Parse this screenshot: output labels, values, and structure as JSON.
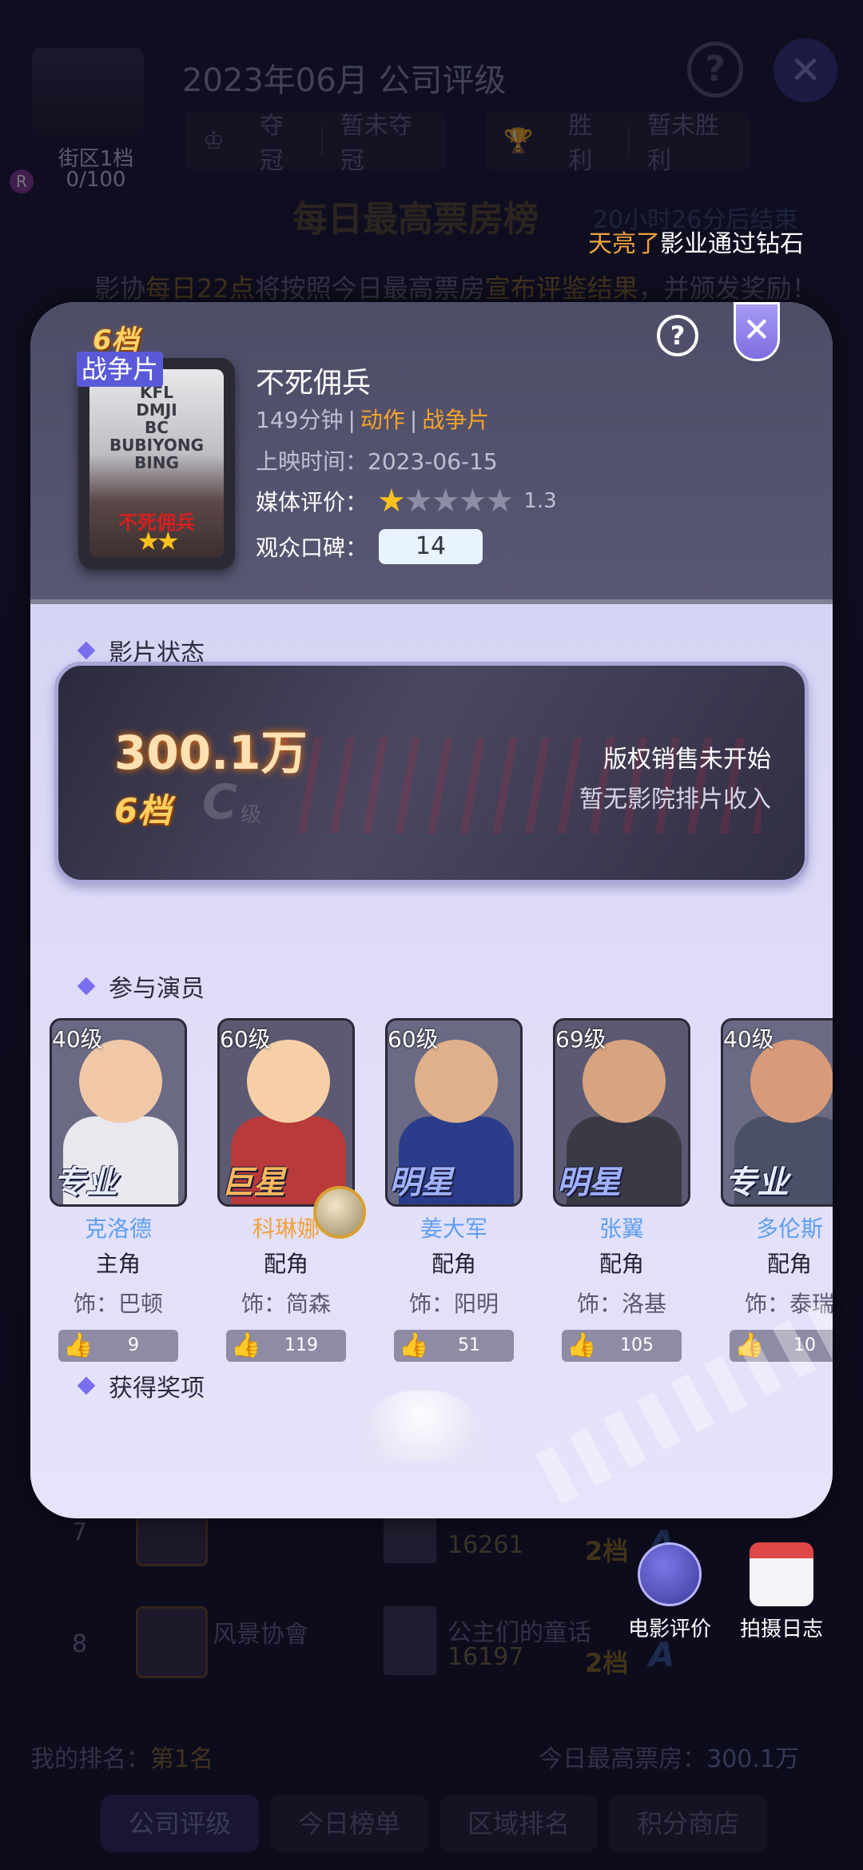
{
  "background": {
    "district_level": "街区1档",
    "progress": "0/100",
    "badge_r": "R",
    "title": "2023年06月 公司评级",
    "help_icon": "help-icon",
    "close_icon": "close-icon",
    "champion": {
      "label": "夺冠",
      "value": "暂未夺冠"
    },
    "victory": {
      "label": "胜利",
      "value": "暂未胜利"
    },
    "banner": "每日最高票房榜",
    "countdown": "20小时26分后结束",
    "ticker": {
      "name": "天亮了",
      "rest": "影业通过钻石"
    },
    "notice": {
      "p1": "影协",
      "h1": "每日22点",
      "p2": "将按照今日最高票房",
      "h2": "宣布评鉴结果",
      "p3": "，并颁发奖励！"
    },
    "rows": [
      {
        "rank": "7",
        "company": "",
        "movie": "",
        "box_office": "16261",
        "tier": "2档",
        "grade": "A"
      },
      {
        "rank": "8",
        "company": "风景协會",
        "movie": "公主们的童话",
        "box_office": "16197",
        "tier": "2档",
        "grade": "A"
      }
    ],
    "my_rank": {
      "label": "我的排名：",
      "value": "第1名"
    },
    "today_best": {
      "label": "今日最高票房：",
      "value": "300.1万"
    },
    "tabs": [
      "公司评级",
      "今日榜单",
      "区域排名",
      "积分商店"
    ]
  },
  "shortcuts": [
    {
      "label": "电影评价",
      "icon": "pen-icon"
    },
    {
      "label": "拍摄日志",
      "icon": "calendar-icon"
    }
  ],
  "movie": {
    "tier_badge": "6档",
    "genre_tag": "战争片",
    "poster_text": "KFL\nDMJI\nBC\nBUBIYONG\nBING",
    "poster_title": "不死佣兵",
    "title": "不死佣兵",
    "duration": "149分钟",
    "genre1": "动作",
    "genre2": "战争片",
    "release_label": "上映时间：",
    "release_date": "2023-06-15",
    "media_label": "媒体评价：",
    "media_stars": 0.5,
    "media_score": "1.3",
    "audience_label": "观众口碑：",
    "audience_score": "14"
  },
  "status": {
    "section_title": "影片状态",
    "box_office": "300.1万",
    "tier": "6档",
    "grade": "C",
    "grade_suffix": "级",
    "copyright": "版权销售未开始",
    "cinema": "暂无影院排片收入"
  },
  "cast_section_title": "参与演员",
  "cast": [
    {
      "level": "40级",
      "rank": "专业",
      "name": "克洛德",
      "role": "主角",
      "character": "饰：巴顿",
      "likes": "9",
      "face": "#f0c8a8",
      "body": "#e8e8ee",
      "bg": "#6a6a84"
    },
    {
      "level": "60级",
      "rank": "巨星",
      "name": "科琳娜",
      "role": "配角",
      "character": "饰：简森",
      "likes": "119",
      "face": "#f6cfa6",
      "body": "#b83a3a",
      "bg": "#5c5a72"
    },
    {
      "level": "60级",
      "rank": "明星",
      "name": "姜大军",
      "role": "配角",
      "character": "饰：阳明",
      "likes": "51",
      "face": "#e0b08a",
      "body": "#2a3c8a",
      "bg": "#6a6a84"
    },
    {
      "level": "69级",
      "rank": "明星",
      "name": "张翼",
      "role": "配角",
      "character": "饰：洛基",
      "likes": "105",
      "face": "#d8a480",
      "body": "#3a3a44",
      "bg": "#5c5a72"
    },
    {
      "level": "40级",
      "rank": "专业",
      "name": "多伦斯",
      "role": "配角",
      "character": "饰：泰瑞",
      "likes": "10",
      "face": "#d89a78",
      "body": "#4a5068",
      "bg": "#6a6a84"
    }
  ],
  "awards_section_title": "获得奖项"
}
